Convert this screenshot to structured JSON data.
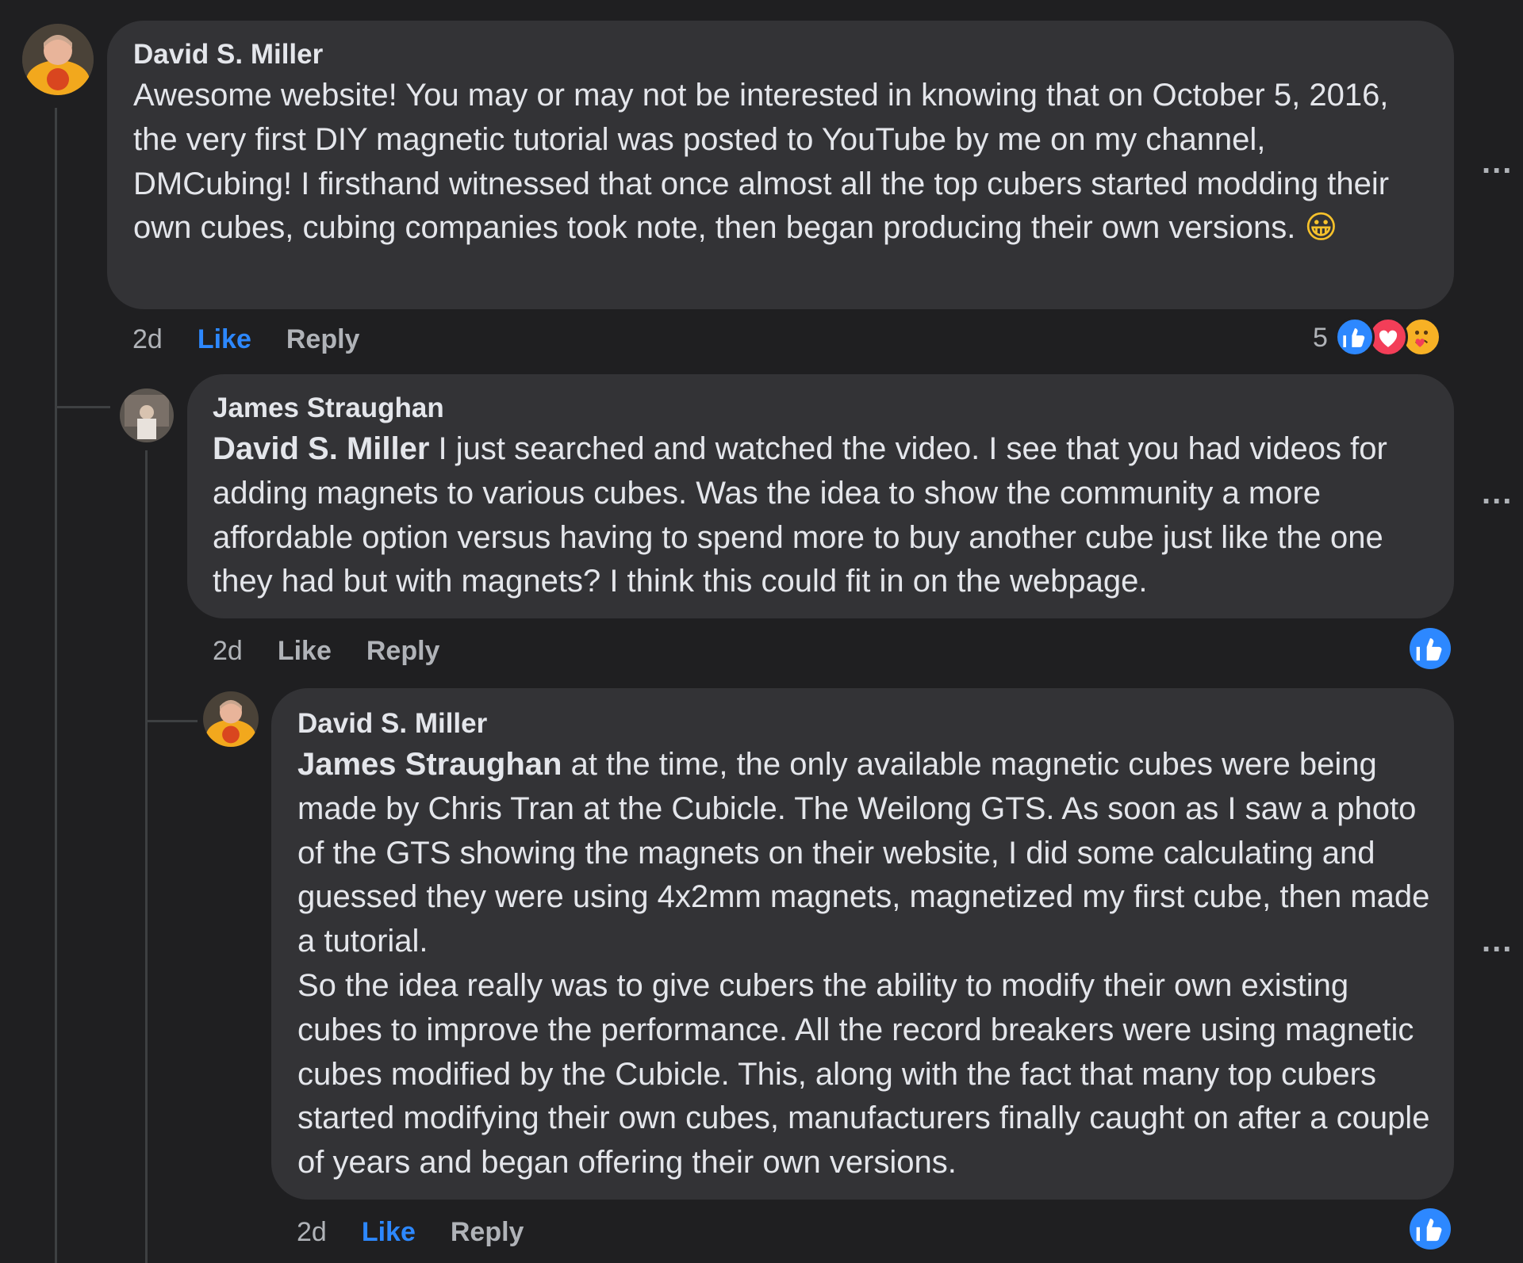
{
  "comments": [
    {
      "author": "David S. Miller",
      "mention": "",
      "text": "Awesome website! You may or may not be interested in knowing that on October 5, 2016, the very first DIY magnetic tutorial was posted to YouTube by me on my channel, DMCubing! I firsthand witnessed that once almost all the top cubers started modding their own cubes, cubing companies took note, then began producing their own versions.",
      "emoji": "😀",
      "time": "2d",
      "like": "Like",
      "like_active": true,
      "reply": "Reply",
      "reaction_count": "5",
      "reactions": [
        "like-icon",
        "love-icon",
        "care-icon"
      ]
    },
    {
      "author": "James Straughan",
      "mention": "David S. Miller",
      "text": " I just searched and watched the video. I see that you had videos for adding magnets to various cubes. Was the idea to show the community a more affordable option versus having to spend more to buy another cube just like the one they had but with magnets? I think this could fit in on the webpage.",
      "time": "2d",
      "like": "Like",
      "like_active": false,
      "reply": "Reply",
      "reactions": [
        "like-icon"
      ]
    },
    {
      "author": "David S. Miller",
      "mention": "James Straughan",
      "text": " at the time, the only available magnetic cubes were being made by Chris Tran at the Cubicle. The Weilong GTS. As soon as I saw a photo of the GTS showing the magnets on their website, I did some calculating and guessed they were using 4x2mm magnets, magnetized my first cube, then made a tutorial.\nSo the idea really was to give cubers the ability to modify their own existing cubes to improve the performance. All the record breakers were using magnetic cubes modified by the Cubicle. This, along with the fact that many top cubers started modifying their own cubes, manufacturers finally caught on after a couple of years and began offering their own versions.",
      "time": "2d",
      "like": "Like",
      "like_active": true,
      "reply": "Reply",
      "reactions": [
        "like-icon"
      ]
    }
  ],
  "more_label": "...",
  "colors": {
    "background": "#1f1f21",
    "bubble": "#333336",
    "text": "#e4e6eb",
    "muted": "#b0b3b8",
    "accent": "#2d88ff",
    "love": "#f33e58",
    "care": "#f7b125"
  }
}
